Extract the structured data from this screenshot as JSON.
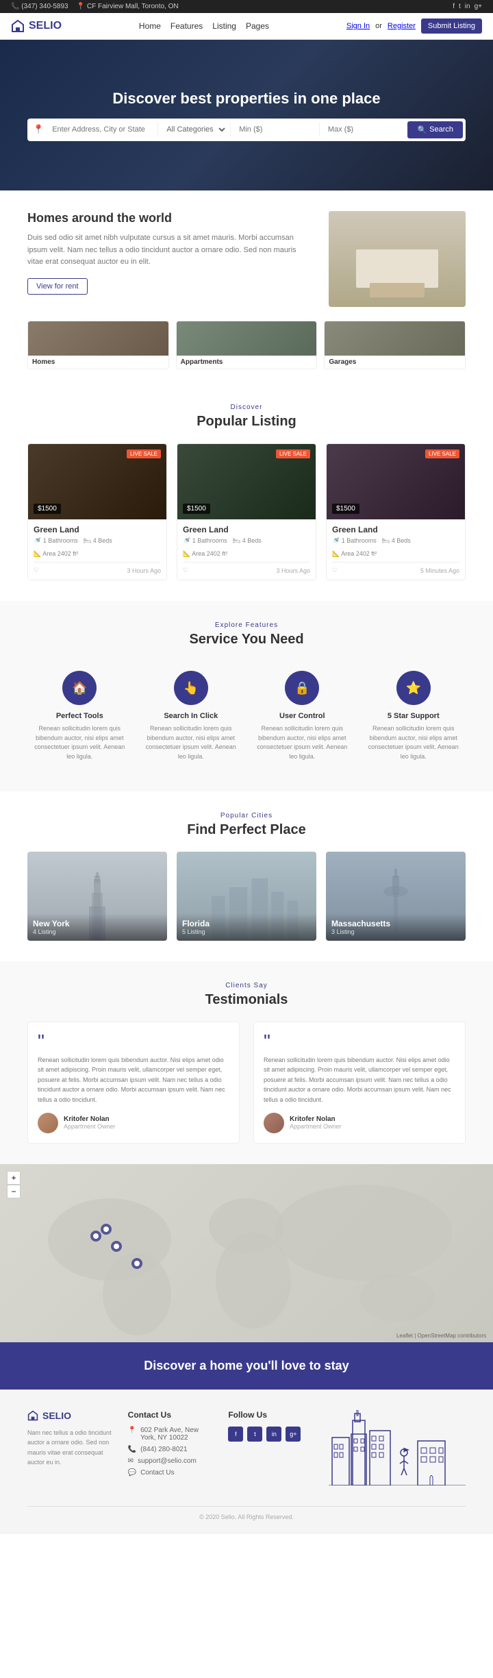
{
  "topbar": {
    "phone": "(347) 340-5893",
    "address": "CF Fairview Mall, Toronto, ON",
    "social": [
      "f",
      "t",
      "in",
      "g"
    ]
  },
  "nav": {
    "logo": "SELIO",
    "links": [
      "Home",
      "Features",
      "Listing",
      "Pages"
    ],
    "signin": "Sign In",
    "or": "or",
    "register": "Register",
    "submit": "Submit Listing"
  },
  "hero": {
    "title": "Discover best properties in one place",
    "search_placeholder": "Enter Address, City or State",
    "category_placeholder": "All Categories",
    "min_placeholder": "Min ($)",
    "max_placeholder": "Max ($)",
    "search_btn": "Search"
  },
  "homes": {
    "title": "Homes around the world",
    "description": "Duis sed odio sit amet nibh vulputate cursus a sit amet mauris. Morbi accumsan ipsum velit. Nam nec tellus a odio tincidunt auctor a ornare odio. Sed non mauris vitae erat consequat auctor eu in elit.",
    "btn_label": "View for rent",
    "categories": [
      {
        "label": "Homes",
        "img_class": "homes"
      },
      {
        "label": "Appartments",
        "img_class": "apartments"
      },
      {
        "label": "Garages",
        "img_class": "garages"
      }
    ]
  },
  "popular_listing": {
    "discover_label": "Discover",
    "title": "Popular Listing",
    "cards": [
      {
        "price": "$1500",
        "badge": "LIVE SALE",
        "title": "Green Land",
        "baths": "1",
        "beds": "4",
        "area": "2402",
        "img_class": "c1",
        "time": "3 Hours Ago"
      },
      {
        "price": "$1500",
        "badge": "LIVE SALE",
        "title": "Green Land",
        "baths": "1",
        "beds": "4",
        "area": "2402",
        "img_class": "c2",
        "time": "3 Hours Ago"
      },
      {
        "price": "$1500",
        "badge": "LIVE SALE",
        "title": "Green Land",
        "baths": "1",
        "beds": "4",
        "area": "2402",
        "img_class": "c3",
        "time": "5 Minutes Ago"
      }
    ]
  },
  "services": {
    "explore_label": "Explore Features",
    "title": "Service You Need",
    "items": [
      {
        "icon": "🏠",
        "title": "Perfect Tools",
        "desc": "Renean sollicitudin lorem quis bibendum auctor, nisi elips amet consectetuer ipsum velit. Aenean leo ligula."
      },
      {
        "icon": "👆",
        "title": "Search In Click",
        "desc": "Renean sollicitudin lorem quis bibendum auctor, nisi elips amet consectetuer ipsum velit. Aenean leo ligula."
      },
      {
        "icon": "🔒",
        "title": "User Control",
        "desc": "Renean sollicitudin lorem quis bibendum auctor, nisi elips amet consectetuer ipsum velit. Aenean leo ligula."
      },
      {
        "icon": "⭐",
        "title": "5 Star Support",
        "desc": "Renean sollicitudin lorem quis bibendum auctor, nisi elips amet consectetuer ipsum velit. Aenean leo ligula."
      }
    ]
  },
  "cities": {
    "popular_label": "Popular Cities",
    "title": "Find Perfect Place",
    "items": [
      {
        "name": "New York",
        "count": "4 Listing",
        "img_class": "new-york"
      },
      {
        "name": "Florida",
        "count": "5 Listing",
        "img_class": "florida"
      },
      {
        "name": "Massachusetts",
        "count": "3 Listing",
        "img_class": "massachusetts"
      }
    ]
  },
  "testimonials": {
    "clients_label": "Clients Say",
    "title": "Testimonials",
    "items": [
      {
        "text": "Renean sollicitudin lorem quis bibendum auctor. Nisi elips amet odio sit amet adipiscing. Proin mauris velit, ullamcorper vel semper eget, posuere at felis. Morbi accumsan ipsum velit. Nam nec tellus a odio tincidunt auctor a ornare odio. Morbi accumsan ipsum velit. Nam nec tellus a odio tincidunt.",
        "name": "Kritofer Nolan",
        "role": "Appartment Owner"
      },
      {
        "text": "Renean sollicitudin lorem quis bibendum auctor. Nisi elips amet odio sit amet adipiscing. Proin mauris velit, ullamcorper vel semper eget, posuere at felis. Morbi accumsan ipsum velit. Nam nec tellus a odio tincidunt auctor a ornare odio. Morbi accumsan ipsum velit. Nam nec tellus a odio tincidunt.",
        "name": "Kritofer Nolan",
        "role": "Appartment Owner"
      }
    ]
  },
  "cta": {
    "text": "Discover a home you'll love to stay"
  },
  "footer": {
    "logo": "SELIO",
    "about": "Nam nec tellus a odio tincidunt auctor a ornare odio. Sed non mauris vitae erat consequat auctor eu in.",
    "contact_title": "Contact Us",
    "contacts": [
      {
        "icon": "📍",
        "text": "602 Park Ave, New York, NY 10022"
      },
      {
        "icon": "📞",
        "text": "(844) 280-8021"
      },
      {
        "icon": "✉",
        "text": "support@selio.com"
      },
      {
        "icon": "💬",
        "text": "Contact Us"
      }
    ],
    "follow_title": "Follow Us",
    "social": [
      "f",
      "t",
      "in",
      "g"
    ]
  }
}
